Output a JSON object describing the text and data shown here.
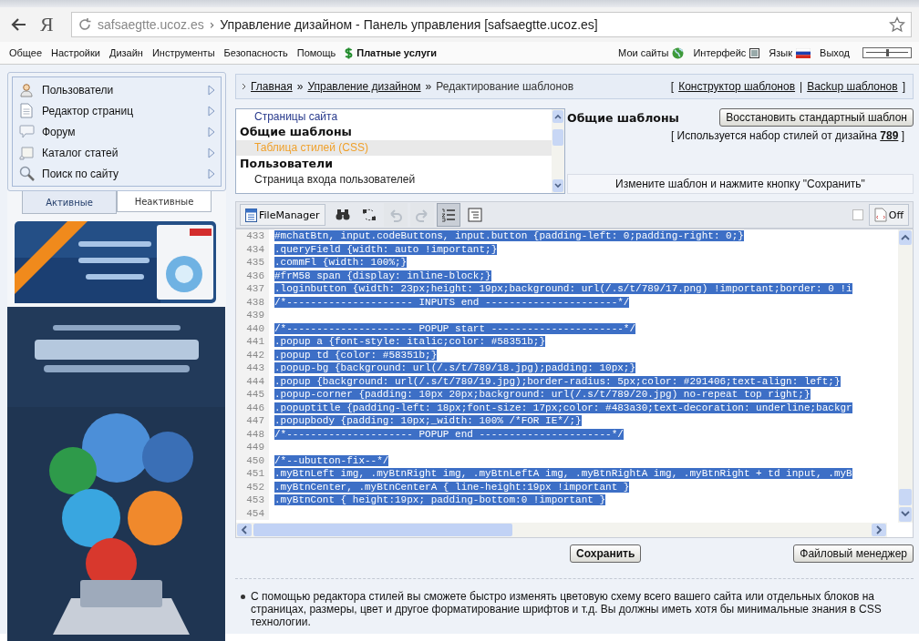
{
  "browser": {
    "logo": "Я",
    "url": "safsaegtte.ucoz.es",
    "separator": "›",
    "title": "Управление дизайном - Панель управления [safsaegtte.ucoz.es]"
  },
  "menu": [
    {
      "label": "Общее",
      "kind": "plain"
    },
    {
      "label": "Настройки",
      "kind": "plain"
    },
    {
      "label": "Дизайн",
      "kind": "plain"
    },
    {
      "label": "Инструменты",
      "kind": "plain"
    },
    {
      "label": "Безопасность",
      "kind": "plain"
    },
    {
      "label": "Помощь",
      "kind": "plain"
    },
    {
      "label": "Платные услуги",
      "kind": "paid"
    }
  ],
  "zoom_slider": {
    "level": 0.5
  },
  "menu_right": [
    {
      "label": "Мои сайты",
      "kind": "globe"
    },
    {
      "label": "Интерфейс",
      "kind": "box"
    },
    {
      "label": "Язык",
      "kind": "flag"
    },
    {
      "label": "Выход",
      "kind": "plain"
    }
  ],
  "sidebar": {
    "items": [
      {
        "label": "Пользователи",
        "kind": "user"
      },
      {
        "label": "Редактор страниц",
        "kind": "page"
      },
      {
        "label": "Форум",
        "kind": "bubble"
      },
      {
        "label": "Каталог статей",
        "kind": "book"
      },
      {
        "label": "Поиск по сайту",
        "kind": "search"
      }
    ],
    "tabs": [
      {
        "label": "Активные",
        "selected": true
      },
      {
        "label": "Неактивные",
        "selected": false
      }
    ]
  },
  "breadcrumb": {
    "links": [
      "Главная",
      "Управление дизайном"
    ],
    "separator": "»",
    "current": "Редактирование шаблонов",
    "open": "[",
    "actions": [
      "Конструктор шаблонов",
      "Backup шаблонов"
    ],
    "divider": "|",
    "close": "]"
  },
  "templates": [
    {
      "kind": "item",
      "label": "Страницы сайта",
      "selected": false
    },
    {
      "kind": "group",
      "label": "Общие шаблоны"
    },
    {
      "kind": "item",
      "label": "Таблица стилей (CSS)",
      "selected": true
    },
    {
      "kind": "group",
      "label": "Пользователи"
    },
    {
      "kind": "item",
      "label": "Страница входа пользователей",
      "selected": false
    }
  ],
  "info": {
    "heading": "Общие шаблоны",
    "restore_button": "Восстановить стандартный шаблон",
    "note_before": "[ Используется набор стилей от дизайна",
    "design_id": "789",
    "note_after": "]",
    "hint": "Измените шаблон и нажмите кнопку \"Сохранить\""
  },
  "toolbar": {
    "file_manager": "FileManager",
    "tools": [
      {
        "kind": "search",
        "disabled": false,
        "pressed": false
      },
      {
        "kind": "replace",
        "disabled": false,
        "pressed": false
      },
      {
        "kind": "undo",
        "disabled": true,
        "pressed": false
      },
      {
        "kind": "redo",
        "disabled": true,
        "pressed": false
      },
      {
        "kind": "numbers",
        "disabled": false,
        "pressed": true
      },
      {
        "kind": "format",
        "disabled": false,
        "pressed": false
      }
    ],
    "checked": false,
    "highlight": "Off"
  },
  "code": {
    "lines": [
      {
        "number": "433",
        "text": "#mchatBtn, input.codeButtons, input.button {padding-left: 0;padding-right: 0;}",
        "selected": true
      },
      {
        "number": "434",
        "text": ".queryField {width: auto !important;}",
        "selected": true
      },
      {
        "number": "435",
        "text": ".commFl {width: 100%;}",
        "selected": true
      },
      {
        "number": "436",
        "text": "#frM58 span {display: inline-block;}",
        "selected": true
      },
      {
        "number": "437",
        "text": ".loginbutton {width: 23px;height: 19px;background: url(/.s/t/789/17.png) !important;border: 0 !i",
        "selected": true
      },
      {
        "number": "438",
        "text": "/*--------------------- INPUTS end ----------------------*/",
        "selected": true
      },
      {
        "number": "439",
        "selected": false
      },
      {
        "number": "440",
        "text": "/*--------------------- POPUP start ----------------------*/",
        "selected": true
      },
      {
        "number": "441",
        "text": ".popup a {font-style: italic;color: #58351b;}",
        "selected": true
      },
      {
        "number": "442",
        "text": ".popup td {color: #58351b;}",
        "selected": true
      },
      {
        "number": "443",
        "text": ".popup-bg {background: url(/.s/t/789/18.jpg);padding: 10px;}",
        "selected": true
      },
      {
        "number": "444",
        "text": ".popup {background: url(/.s/t/789/19.jpg);border-radius: 5px;color: #291406;text-align: left;}",
        "selected": true
      },
      {
        "number": "445",
        "text": ".popup-corner {padding: 10px 20px;background: url(/.s/t/789/20.jpg) no-repeat top right;}",
        "selected": true
      },
      {
        "number": "446",
        "text": ".popuptitle {padding-left: 18px;font-size: 17px;color: #483a30;text-decoration: underline;backgr",
        "selected": true
      },
      {
        "number": "447",
        "text": ".popupbody {padding: 10px;_width: 100% /*FOR IE*/;}",
        "selected": true
      },
      {
        "number": "448",
        "text": "/*--------------------- POPUP end ----------------------*/",
        "selected": true
      },
      {
        "number": "449",
        "selected": false
      },
      {
        "number": "450",
        "text": "/*--ubutton-fix--*/",
        "selected": true
      },
      {
        "number": "451",
        "text": ".myBtnLeft img, .myBtnRight img, .myBtnLeftA img, .myBtnRightA img, .myBtnRight + td input, .myB",
        "selected": true
      },
      {
        "number": "452",
        "text": ".myBtnCenter, .myBtnCenterA { line-height:19px !important }",
        "selected": true
      },
      {
        "number": "453",
        "text": ".myBtnCont { height:19px; padding-bottom:0 !important }",
        "selected": true
      },
      {
        "number": "454",
        "selected": false
      }
    ]
  },
  "buttons": {
    "save": "Сохранить",
    "file_manager": "Файловый менеджер"
  },
  "note": "С помощью редактора стилей вы сможете быстро изменять цветовую схему всего вашего сайта или отдельных блоков на страницах, размеры, цвет и другое форматирование шрифтов и т.д. Вы должны иметь хотя бы минимальные знания в CSS технологии."
}
